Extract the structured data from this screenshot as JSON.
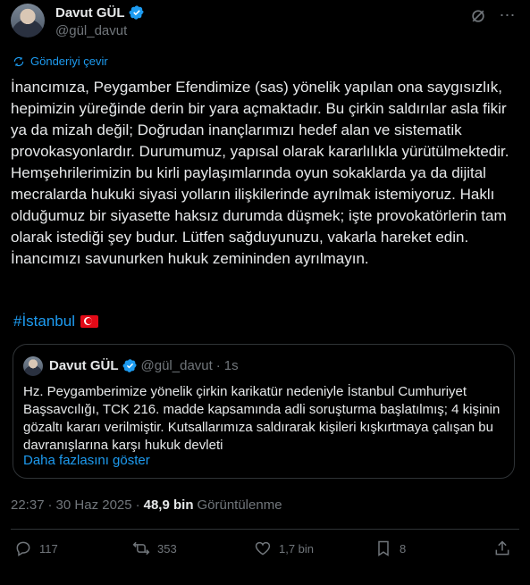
{
  "author": {
    "name": "Davut GÜL",
    "handle": "@gül_davut"
  },
  "translate_label": "Gönderiyi çevir",
  "tweet_text": "İnancımıza, Peygamber Efendimize (sas) yönelik yapılan ona saygısızlık, hepimizin yüreğinde derin bir yara açmaktadır. Bu çirkin saldırılar asla fikir ya da mizah değil; Doğrudan inançlarımızı hedef alan ve sistematik provokasyonlardır. Durumumuz, yapısal olarak kararlılıkla yürütülmektedir. Hemşehrilerimizin bu kirli paylaşımlarında oyun sokaklarda ya da dijital mecralarda hukuki siyasi yolların ilişkilerinde ayrılmak istemiyoruz. Haklı olduğumuz bir siyasette haksız durumda düşmek; işte provokatörlerin tam olarak istediği şey budur. Lütfen sağduyunuzu, vakarla hareket edin. İnancımızı savunurken hukuk zemininden ayrılmayın.",
  "hashtag": "#İstanbul",
  "quote": {
    "name": "Davut GÜL",
    "handle": "@gül_davut",
    "dot": "·",
    "time": "1s",
    "text": "Hz. Peygamberimize yönelik çirkin karikatür nedeniyle İstanbul Cumhuriyet Başsavcılığı, TCK 216. madde kapsamında adli soruşturma başlatılmış; 4 kişinin gözaltı kararı verilmiştir. Kutsallarımıza saldırarak kişileri kışkırtmaya çalışan bu davranışlarına karşı hukuk devleti",
    "show_more": "Daha fazlasını göster"
  },
  "meta": {
    "time": "22:37",
    "sep": "·",
    "date": "30 Haz 2025",
    "sep2": "·",
    "views": "48,9 bin",
    "views_label": "Görüntülenme"
  },
  "actions": {
    "replies": "117",
    "reposts": "353",
    "likes": "1,7 bin",
    "bookmarks": "8"
  },
  "colors": {
    "background": "#000000",
    "accent": "#1d9bf0",
    "muted": "#71767b",
    "text": "#e7e9ea"
  },
  "icons": [
    "verified-badge-icon",
    "grok-icon",
    "more-icon",
    "translate-icon",
    "turkey-flag-icon",
    "reply-icon",
    "repost-icon",
    "like-icon",
    "bookmark-icon",
    "share-icon"
  ]
}
